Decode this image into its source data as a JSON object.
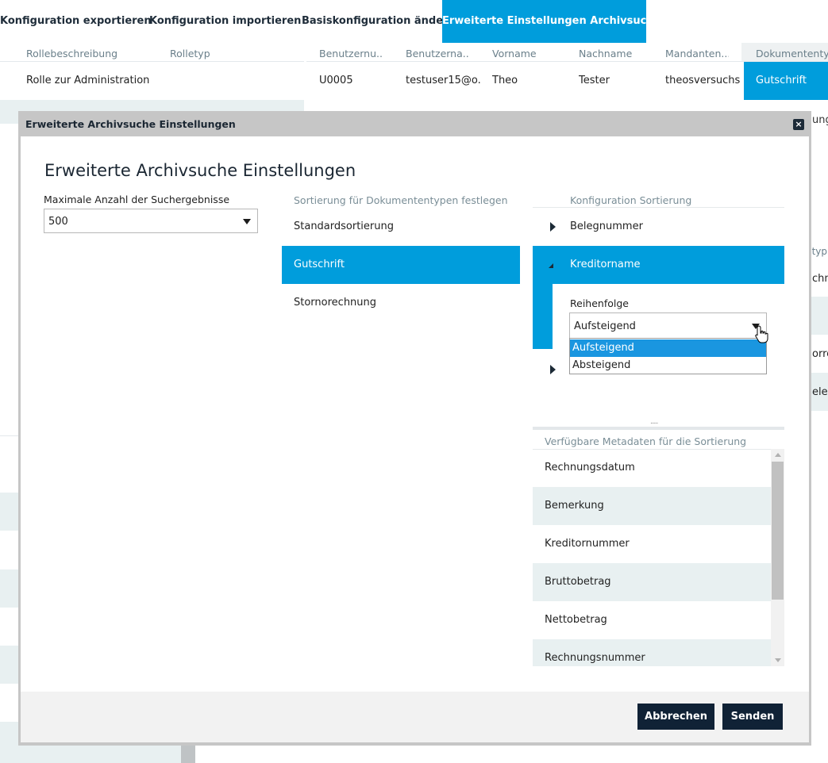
{
  "top_tabs": [
    {
      "label": "Konfiguration exportieren"
    },
    {
      "label": "Konfiguration importieren"
    },
    {
      "label": "Basiskonfiguration ändern"
    },
    {
      "label": "Erweiterte Einstellungen Archivsuche",
      "active": true
    }
  ],
  "roles_grid": {
    "headers": [
      "Rollebeschreibung",
      "Rolletyp"
    ],
    "row": [
      "Rolle zur Administration",
      ""
    ]
  },
  "users_grid": {
    "headers": [
      "Benutzernu...",
      "Benutzerna...",
      "Vorname",
      "Nachname",
      "Mandanten...",
      "Dokumententyp"
    ],
    "row": [
      "U0005",
      "testuser15@o...",
      "Theo",
      "Tester",
      "theosversuchs...",
      "Gutschrift"
    ]
  },
  "bg_right_fragments": [
    "ung",
    "ntyp",
    "chnu",
    "orre",
    "eleg"
  ],
  "modal": {
    "title": "Erweiterte Archivsuche Einstellungen",
    "heading": "Erweiterte Archivsuche Einstellungen",
    "max_results_label": "Maximale Anzahl der Suchergebnisse",
    "max_results_value": "500",
    "doc_types_header": "Sortierung für Dokumententypen festlegen",
    "doc_types": [
      {
        "label": "Standardsortierung"
      },
      {
        "label": "Gutschrift",
        "selected": true
      },
      {
        "label": "Stornorechnung"
      }
    ],
    "config_header": "Konfiguration Sortierung",
    "config_items": [
      {
        "label": "Belegnummer",
        "expanded": false
      },
      {
        "label": "Kreditorname",
        "expanded": true
      },
      {
        "label": "",
        "expanded": false
      }
    ],
    "order_label": "Reihenfolge",
    "order_value": "Aufsteigend",
    "order_options": [
      {
        "label": "Aufsteigend",
        "highlighted": true
      },
      {
        "label": "Absteigend"
      }
    ],
    "splitter_grip": ".....",
    "metadata_header": "Verfügbare Metadaten für die Sortierung",
    "metadata_items": [
      "Rechnungsdatum",
      "Bemerkung",
      "Kreditornummer",
      "Bruttobetrag",
      "Nettobetrag",
      "Rechnungsnummer"
    ],
    "close_glyph": "×",
    "cancel_label": "Abbrechen",
    "submit_label": "Senden"
  },
  "colors": {
    "accent": "#009ddc",
    "dark": "#102236",
    "stripe": "#e8f0f1"
  }
}
